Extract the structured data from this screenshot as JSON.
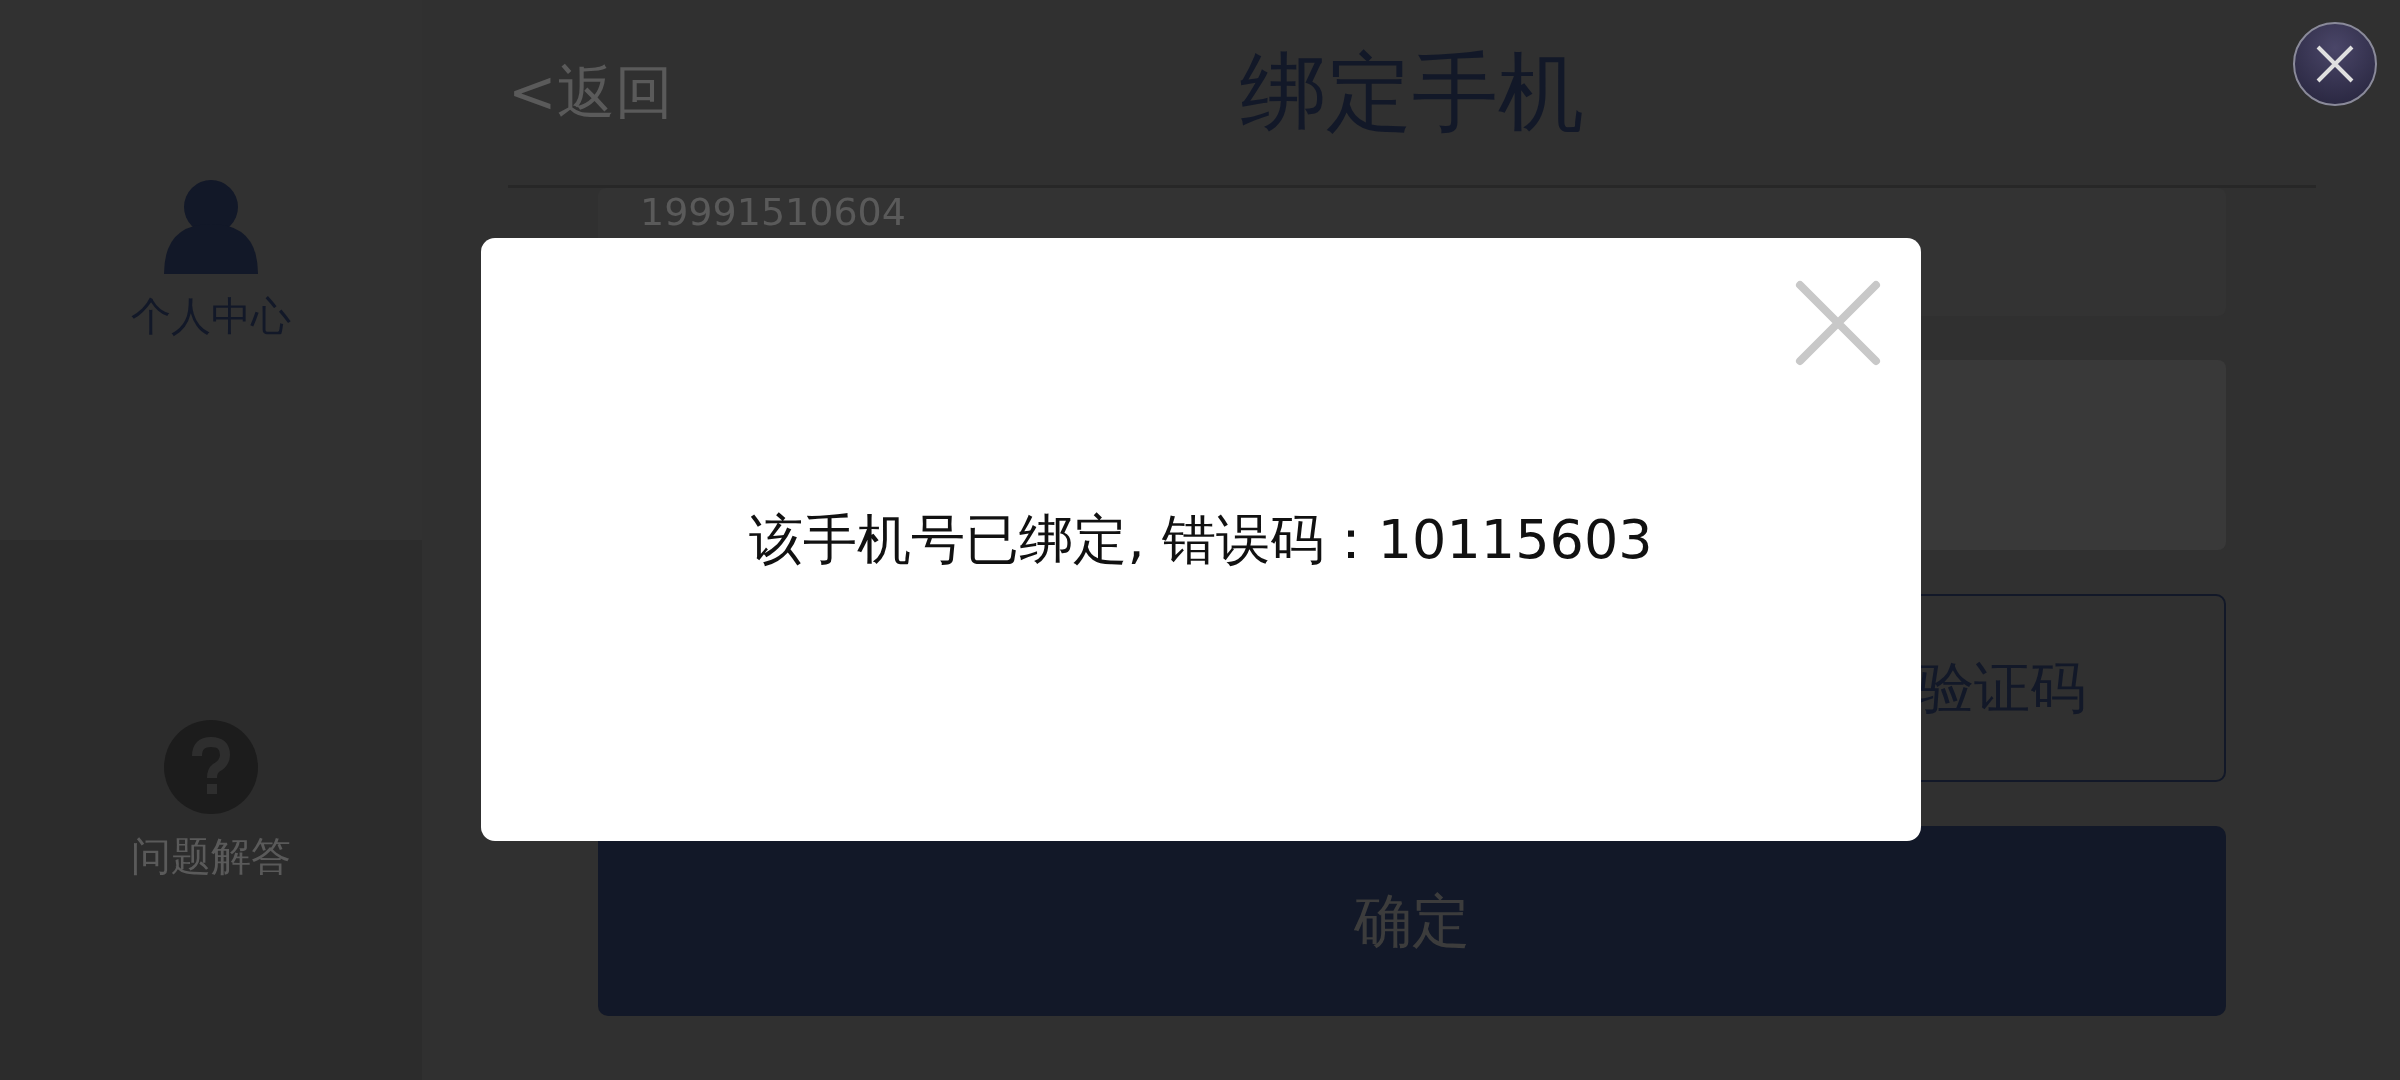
{
  "sidebar": {
    "items": [
      {
        "kind": "person",
        "label": "个人中心",
        "selected": true
      },
      {
        "kind": "help",
        "label": "问题解答",
        "selected": false
      }
    ]
  },
  "header": {
    "back": "<返回",
    "title": "绑定手机"
  },
  "form": {
    "phone": {
      "value": "19991510604"
    },
    "code_button": "验证码",
    "submit": "确定"
  },
  "dialog": {
    "message": "该手机号已绑定, 错误码：10115603"
  }
}
